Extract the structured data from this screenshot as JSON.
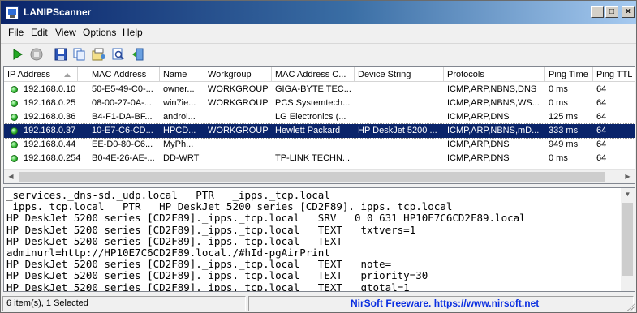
{
  "window": {
    "title": "LANIPScanner"
  },
  "menu": {
    "items": [
      "File",
      "Edit",
      "View",
      "Options",
      "Help"
    ]
  },
  "toolbar": {
    "icons": [
      "play-icon",
      "stop-icon",
      "save-icon",
      "copy-icon",
      "properties-icon",
      "find-icon",
      "exit-icon"
    ]
  },
  "table": {
    "columns": [
      "IP Address",
      "MAC Address",
      "Name",
      "Workgroup",
      "MAC Address C...",
      "Device String",
      "Protocols",
      "Ping Time",
      "Ping TTL"
    ],
    "sort_column": "IP Address",
    "rows": [
      [
        "192.168.0.10",
        "50-E5-49-C0-...",
        "owner...",
        "WORKGROUP",
        "GIGA-BYTE TEC...",
        "",
        "ICMP,ARP,NBNS,DNS",
        "0 ms",
        "64"
      ],
      [
        "192.168.0.25",
        "08-00-27-0A-...",
        "win7ie...",
        "WORKGROUP",
        "PCS Systemtech...",
        "",
        "ICMP,ARP,NBNS,WS...",
        "0 ms",
        "64"
      ],
      [
        "192.168.0.36",
        "B4-F1-DA-BF...",
        "androi...",
        "",
        "LG Electronics (...",
        "",
        "ICMP,ARP,DNS",
        "125 ms",
        "64"
      ],
      [
        "192.168.0.37",
        "10-E7-C6-CD...",
        "HPCD...",
        "WORKGROUP",
        "Hewlett Packard",
        "HP DeskJet 5200 ...",
        "ICMP,ARP,NBNS,mD...",
        "333 ms",
        "64"
      ],
      [
        "192.168.0.44",
        "EE-D0-80-C6...",
        "MyPh...",
        "",
        "",
        "",
        "ICMP,ARP,DNS",
        "949 ms",
        "64"
      ],
      [
        "192.168.0.254",
        "B0-4E-26-AE-...",
        "DD-WRT",
        "",
        "TP-LINK TECHN...",
        "",
        "ICMP,ARP,DNS",
        "0 ms",
        "64"
      ]
    ],
    "selected_index": 3
  },
  "details": {
    "lines": [
      "_services._dns-sd._udp.local   PTR   _ipps._tcp.local",
      "_ipps._tcp.local   PTR   HP DeskJet 5200 series [CD2F89]._ipps._tcp.local",
      "HP DeskJet 5200 series [CD2F89]._ipps._tcp.local   SRV   0 0 631 HP10E7C6CD2F89.local",
      "HP DeskJet 5200 series [CD2F89]._ipps._tcp.local   TEXT   txtvers=1",
      "HP DeskJet 5200 series [CD2F89]._ipps._tcp.local   TEXT",
      "adminurl=http://HP10E7C6CD2F89.local./#hId-pgAirPrint",
      "HP DeskJet 5200 series [CD2F89]._ipps._tcp.local   TEXT   note=",
      "HP DeskJet 5200 series [CD2F89]._ipps._tcp.local   TEXT   priority=30",
      "HP DeskJet 5200 series [CD2F89]._ipps._tcp.local   TEXT   qtotal=1"
    ]
  },
  "statusbar": {
    "count": "6 item(s), 1 Selected",
    "link": "NirSoft Freeware. https://www.nirsoft.net"
  },
  "colors": {
    "selection": "#0a246a",
    "link": "#0a2ee0",
    "status_ok": "#2fb52f"
  }
}
